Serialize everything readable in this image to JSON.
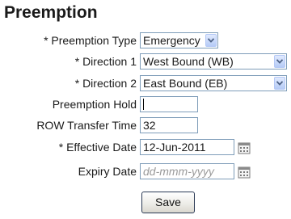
{
  "page": {
    "title": "Preemption"
  },
  "form": {
    "preemption_type": {
      "label": "* Preemption Type",
      "value": "Emergency"
    },
    "direction_1": {
      "label": "* Direction 1",
      "value": "West Bound (WB)"
    },
    "direction_2": {
      "label": "* Direction 2",
      "value": "East Bound (EB)"
    },
    "preemption_hold": {
      "label": "Preemption Hold",
      "value": ""
    },
    "row_transfer_time": {
      "label": "ROW Transfer Time",
      "value": "32"
    },
    "effective_date": {
      "label": "* Effective Date",
      "value": "12-Jun-2011"
    },
    "expiry_date": {
      "label": "Expiry Date",
      "value": "",
      "placeholder": "dd-mmm-yyyy"
    },
    "save_label": "Save"
  },
  "icons": {
    "dropdown": "chevron-down-icon",
    "calendar": "calendar-icon"
  }
}
